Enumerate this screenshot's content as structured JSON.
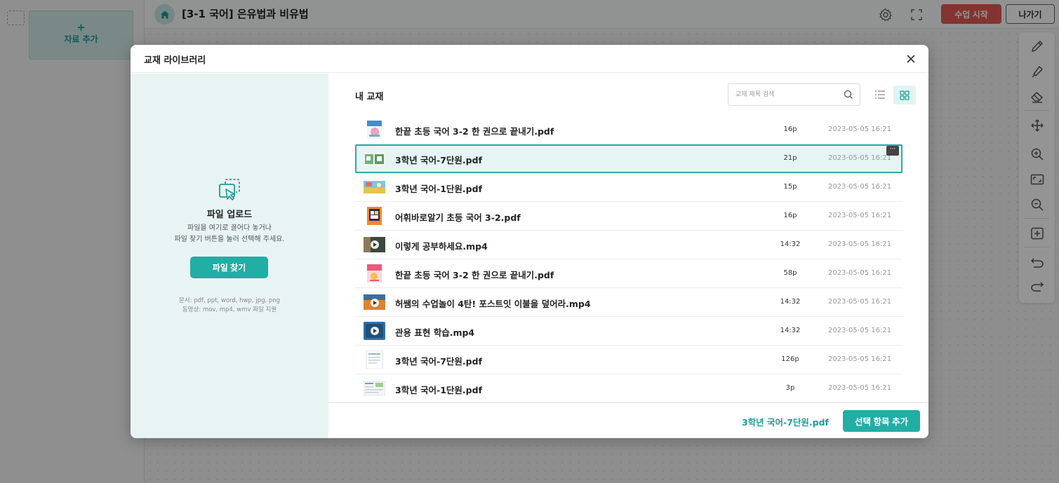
{
  "header": {
    "lesson_title": "[3-1 국어] 은유법과 비유법",
    "start_label": "수업 시작",
    "exit_label": "나가기"
  },
  "left_panel": {
    "add_plus": "+",
    "add_label": "자료 추가"
  },
  "toolbar": {
    "tools": [
      "pencil-icon",
      "highlighter-icon",
      "eraser-icon",
      "move-icon",
      "zoom-in-icon",
      "fit-screen-icon",
      "zoom-out-icon",
      "add-page-icon",
      "undo-icon",
      "redo-icon"
    ]
  },
  "modal": {
    "title": "교재 라이브러리",
    "upload": {
      "title": "파일 업로드",
      "desc_line1": "파일을 여기로 끌어다 놓거나",
      "desc_line2": "파일 찾기 버튼을 눌러 선택해 주세요.",
      "browse_label": "파일 찾기",
      "formats_line1": "문서: pdf, ppt, word, hwp, jpg, png",
      "formats_line2": "동영상: mov, mp4, wmv 파일 지원"
    },
    "library": {
      "section_title": "내 교재",
      "search_placeholder": "교재 제목 검색",
      "files": [
        {
          "name": "한끝 초등 국어 3-2 한 권으로 끝내기.pdf",
          "length": "16p",
          "date": "2023-05-05 16:21",
          "selected": false,
          "thumb": "book-blue"
        },
        {
          "name": "3학년 국어-7단원.pdf",
          "length": "21p",
          "date": "2023-05-05 16:21",
          "selected": true,
          "thumb": "slide-green"
        },
        {
          "name": "3학년 국어-1단원.pdf",
          "length": "15p",
          "date": "2023-05-05 16:21",
          "selected": false,
          "thumb": "slide-yellow"
        },
        {
          "name": "어휘바로알기 초등 국어 3-2.pdf",
          "length": "16p",
          "date": "2023-05-05 16:21",
          "selected": false,
          "thumb": "book-orange"
        },
        {
          "name": "이렇게 공부하세요.mp4",
          "length": "14:32",
          "date": "2023-05-05 16:21",
          "selected": false,
          "thumb": "video-dark"
        },
        {
          "name": "한끝 초등 국어 3-2 한 권으로 끝내기.pdf",
          "length": "58p",
          "date": "2023-05-05 16:21",
          "selected": false,
          "thumb": "book-pink"
        },
        {
          "name": "허쌤의 수업놀이 4탄! 포스트잇 이불을 덮어라.mp4",
          "length": "14:32",
          "date": "2023-05-05 16:21",
          "selected": false,
          "thumb": "video-orange"
        },
        {
          "name": "관용 표현 학습.mp4",
          "length": "14:32",
          "date": "2023-05-05 16:21",
          "selected": false,
          "thumb": "video-blue"
        },
        {
          "name": "3학년 국어-7단원.pdf",
          "length": "126p",
          "date": "2023-05-05 16:21",
          "selected": false,
          "thumb": "doc-white"
        },
        {
          "name": "3학년 국어-1단원.pdf",
          "length": "3p",
          "date": "2023-05-05 16:21",
          "selected": false,
          "thumb": "doc-light"
        }
      ]
    },
    "footer": {
      "selected_name": "3학년 국어-7단원.pdf",
      "add_label": "선택 항목 추가"
    }
  },
  "colors": {
    "accent": "#22ada5",
    "start_button": "#e25a55"
  }
}
